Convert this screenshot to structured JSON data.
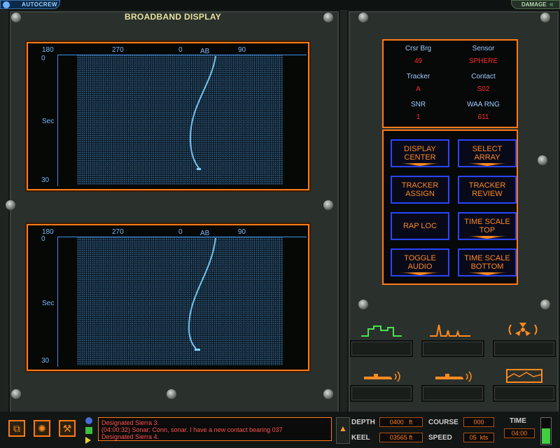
{
  "topbar": {
    "autocrew_label": "AUTOCREW",
    "damage_label": "DAMAGE"
  },
  "title": "BROADBAND DISPLAY",
  "displays": [
    {
      "x_ticks": [
        "180",
        "270",
        "0",
        "AB",
        "90"
      ],
      "y_top": "0",
      "y_mid": "Sec",
      "y_bottom": "30"
    },
    {
      "x_ticks": [
        "180",
        "270",
        "0",
        "AB",
        "90"
      ],
      "y_top": "0",
      "y_mid": "Sec",
      "y_bottom": "30"
    }
  ],
  "info": {
    "crsr_brg_label": "Crsr Brg",
    "crsr_brg_value": "49",
    "sensor_label": "Sensor",
    "sensor_value": "SPHERE",
    "tracker_label": "Tracker",
    "tracker_value": "A",
    "contact_label": "Contact",
    "contact_value": "S02",
    "snr_label": "SNR",
    "snr_value": "1",
    "waa_rng_label": "WAA RNG",
    "waa_rng_value": "611"
  },
  "buttons": [
    {
      "line1": "DISPLAY",
      "line2": "CENTER"
    },
    {
      "line1": "SELECT",
      "line2": "ARRAY"
    },
    {
      "line1": "TRACKER",
      "line2": "ASSIGN"
    },
    {
      "line1": "TRACKER",
      "line2": "REVIEW"
    },
    {
      "line1": "RAP LOC",
      "line2": ""
    },
    {
      "line1": "TIME SCALE",
      "line2": "TOP"
    },
    {
      "line1": "TOGGLE",
      "line2": "AUDIO"
    },
    {
      "line1": "TIME SCALE",
      "line2": "BOTTOM"
    }
  ],
  "icons_row1": [
    "broadband-icon",
    "narrowband-icon",
    "propeller-icon"
  ],
  "icons_row2": [
    "sub-sound-icon",
    "sub-sound-icon",
    "terrain-icon"
  ],
  "log": {
    "line1": "Designated Sierra 3.",
    "line2": "(04:00:32) Sonar: Conn, sonar. I have a new contact bearing 037",
    "line3": "Designated Sierra 4."
  },
  "status": {
    "depth_label": "DEPTH",
    "depth_value": "0400",
    "depth_unit": "ft",
    "keel_label": "KEEL",
    "keel_value": "03565 ft",
    "course_label": "COURSE",
    "course_value": "000",
    "speed_label": "SPEED",
    "speed_value": "05",
    "speed_unit": "kts",
    "time_label": "TIME",
    "time_value": "04:00"
  },
  "colors": {
    "accent": "#ff7a1a",
    "button_border": "#2a45ff",
    "trace": "#7fd3ff"
  }
}
